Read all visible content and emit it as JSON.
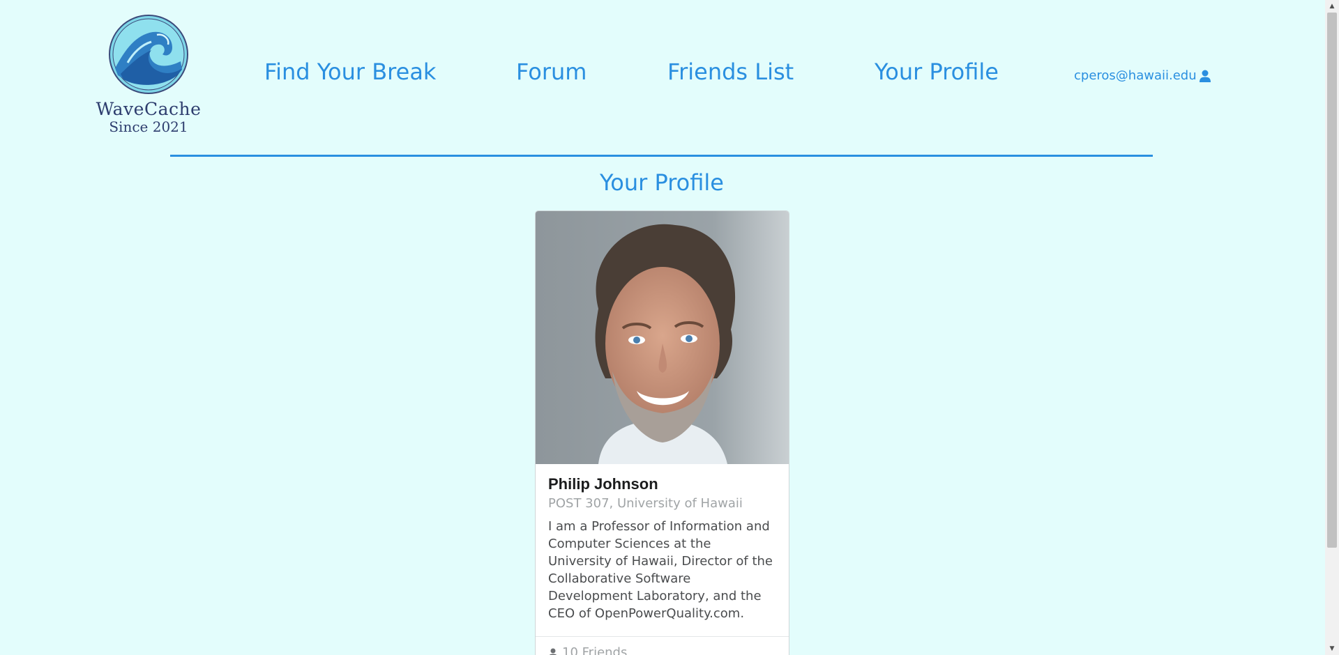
{
  "brand": {
    "name": "WaveCache",
    "since": "Since 2021"
  },
  "nav": {
    "find_break": "Find Your Break",
    "forum": "Forum",
    "friends_list": "Friends List",
    "your_profile": "Your Profile",
    "user_email": "cperos@hawaii.edu"
  },
  "page": {
    "title": "Your Profile"
  },
  "profile": {
    "name": "Philip Johnson",
    "location": "POST 307, University of Hawaii",
    "description": "I am a Professor of Information and Computer Sciences at the University of Hawaii, Director of the Collaborative Software Development Laboratory, and the CEO of OpenPowerQuality.com.",
    "friends": "10 Friends"
  },
  "colors": {
    "background": "#e3fdfc",
    "accent": "#2a8fe0",
    "logo_text": "#2d3d6e"
  },
  "icons": {
    "user": "user-icon",
    "friends": "friends-icon"
  }
}
